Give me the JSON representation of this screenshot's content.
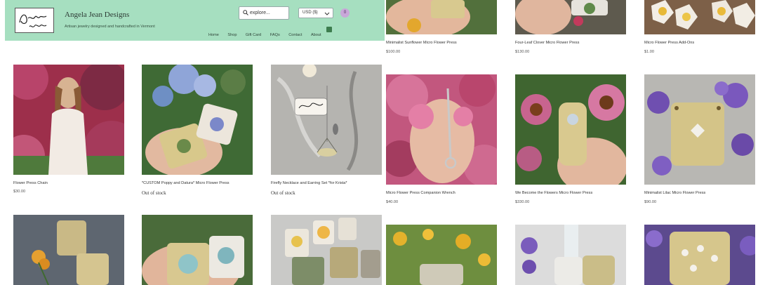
{
  "header": {
    "logo_text": "Angela JEAN",
    "brand": "Angela Jean Designs",
    "tagline": "Artisan jewelry designed and handcrafted in Vermont",
    "search_placeholder": "explore...",
    "currency": "USD ($)",
    "cart_count": "0",
    "nav": [
      "Home",
      "Shop",
      "Gift Card",
      "FAQs",
      "Contact",
      "About"
    ]
  },
  "products_left": [
    {
      "name": "Flower Press Chain",
      "price": "$30.00",
      "status": ""
    },
    {
      "name": "*CUSTOM Poppy and Datura* Micro Flower Press",
      "price": "",
      "status": "Out of stock"
    },
    {
      "name": "Firefly Necklace and Earring Set *for Krista*",
      "price": "",
      "status": "Out of stock"
    }
  ],
  "products_right_top": [
    {
      "name": "Minimalist Sunflower Micro Flower Press",
      "price": "$100.00"
    },
    {
      "name": "Four-Leaf Clover Micro Flower Press",
      "price": "$130.00"
    },
    {
      "name": "Micro Flower Press Add-Ons",
      "price": "$1.00"
    }
  ],
  "products_right_mid": [
    {
      "name": "Micro Flower Press Companion Wrench",
      "price": "$40.00"
    },
    {
      "name": "We Become the Flowers Micro Flower Press",
      "price": "$330.00"
    },
    {
      "name": "Minimalist Lilac Micro Flower Press",
      "price": "$90.00"
    }
  ],
  "colors": {
    "header_bg": "#a6dfc0",
    "cart_badge": "#c9a7d9"
  }
}
